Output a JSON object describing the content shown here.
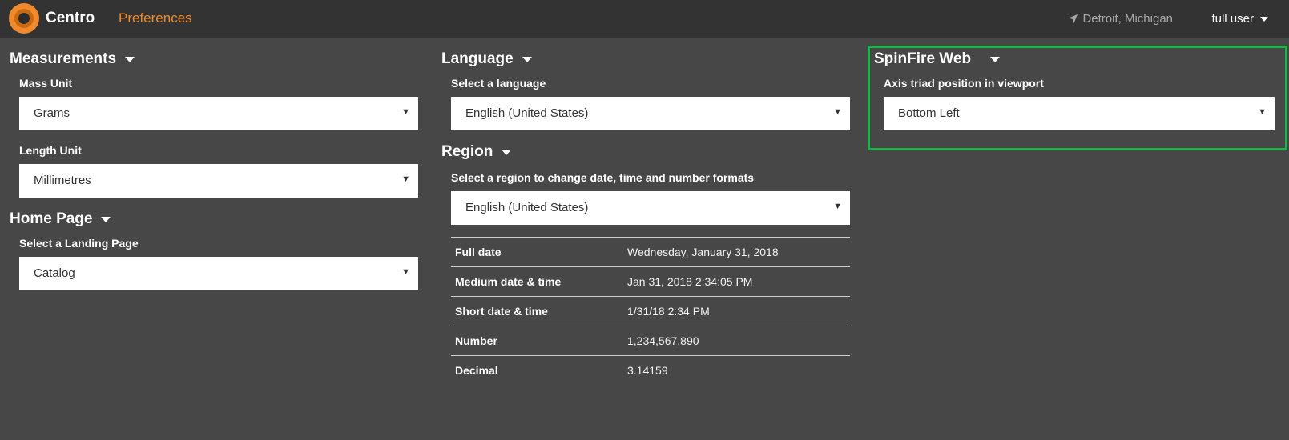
{
  "header": {
    "brand": "Centro",
    "page_link": "Preferences",
    "location": "Detroit, Michigan",
    "user": "full user"
  },
  "measurements": {
    "title": "Measurements",
    "mass_label": "Mass Unit",
    "mass_value": "Grams",
    "length_label": "Length Unit",
    "length_value": "Millimetres"
  },
  "home_page": {
    "title": "Home Page",
    "landing_label": "Select a Landing Page",
    "landing_value": "Catalog"
  },
  "language": {
    "title": "Language",
    "select_label": "Select a language",
    "value": "English (United States)"
  },
  "region": {
    "title": "Region",
    "select_label": "Select a region to change date, time and number formats",
    "value": "English (United States)",
    "formats": [
      {
        "label": "Full date",
        "value": "Wednesday, January 31, 2018"
      },
      {
        "label": "Medium date & time",
        "value": "Jan 31, 2018 2:34:05 PM"
      },
      {
        "label": "Short date & time",
        "value": "1/31/18 2:34 PM"
      },
      {
        "label": "Number",
        "value": "1,234,567,890"
      },
      {
        "label": "Decimal",
        "value": "3.14159"
      }
    ]
  },
  "spinfire": {
    "title": "SpinFire Web",
    "axis_label": "Axis triad position in viewport",
    "axis_value": "Bottom Left"
  },
  "colors": {
    "background": "#474747",
    "topbar": "#333333",
    "accent": "#f08a2c",
    "highlight": "#1fb24a"
  }
}
